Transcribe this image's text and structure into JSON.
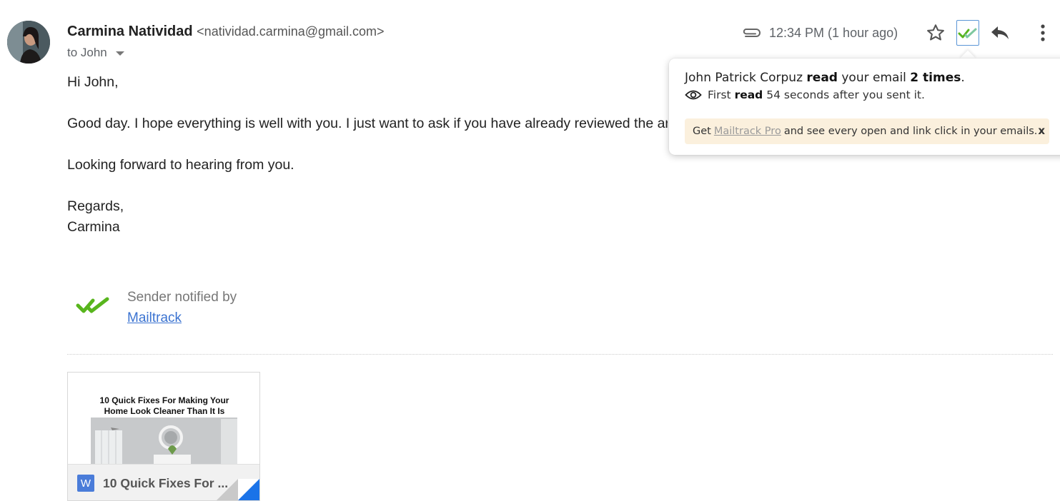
{
  "sender": {
    "name": "Carmina Natividad",
    "email": "<natividad.carmina@gmail.com>",
    "recipient": "to John"
  },
  "header": {
    "timestamp": "12:34 PM (1 hour ago)",
    "icons": [
      "paperclip-icon",
      "star-icon",
      "mailtrack-double-check-icon",
      "reply-icon",
      "more-vert-icon"
    ]
  },
  "popover": {
    "reader_name": "John Patrick Corpuz",
    "read_word": "read",
    "mid_text": "your email",
    "count": "2 times",
    "period": ".",
    "first_prefix": "First",
    "first_read": "read",
    "first_suffix": "54 seconds after you sent it.",
    "banner_get": "Get",
    "banner_link": "Mailtrack Pro",
    "banner_rest": "and see every open and link click in your emails.",
    "close_label": "x"
  },
  "body": {
    "greeting": "Hi John,",
    "paragraph1": "Good day. I hope everything is well with you. I just want to ask if you have already reviewed the ar",
    "paragraph2": "Looking forward to hearing from you.",
    "closing": "Regards,",
    "signature_name": "Carmina"
  },
  "mailtrack": {
    "notified_text": "Sender notified by",
    "link_text": "Mailtrack",
    "check_color": "#58b51d"
  },
  "attachment": {
    "doc_title_line1": "10 Quick Fixes For Making Your",
    "doc_title_line2": "Home Look Cleaner Than It Is",
    "file_label": "10 Quick Fixes For ...",
    "word_icon_letter": "W"
  },
  "colors": {
    "accent_blue": "#4a7cd9",
    "link_blue": "#3b73d1",
    "banner_bg": "#fbf0dd",
    "mailtrack_green": "#58b51d"
  }
}
